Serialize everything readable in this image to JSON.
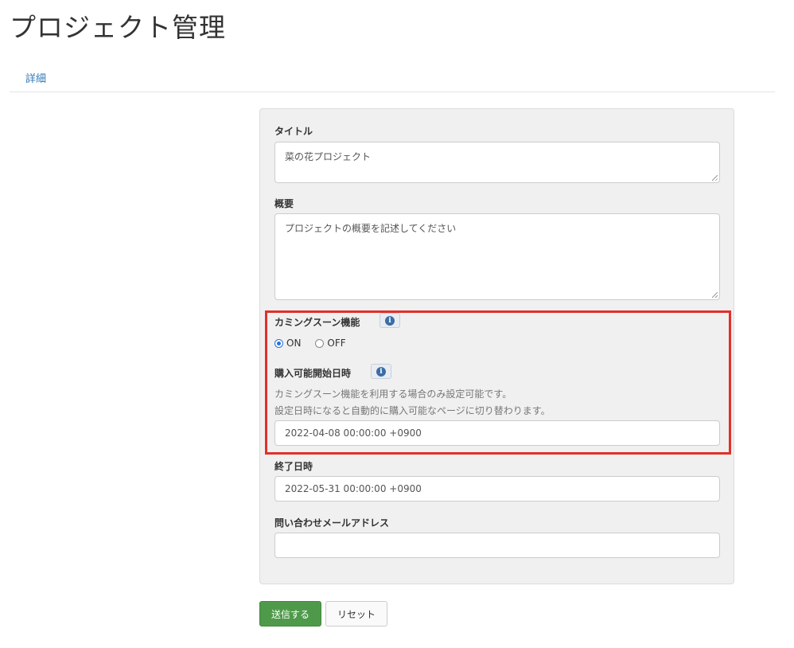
{
  "page": {
    "title": "プロジェクト管理"
  },
  "nav": {
    "tab_detail": "詳細"
  },
  "form": {
    "title_label": "タイトル",
    "title_value": "菜の花プロジェクト",
    "summary_label": "概要",
    "summary_placeholder": "プロジェクトの概要を記述してください",
    "coming_soon_label": "カミングスーン機能",
    "coming_soon_options": [
      "ON",
      "OFF"
    ],
    "coming_soon_selected": "ON",
    "purchase_start_label": "購入可能開始日時",
    "purchase_start_help_1": "カミングスーン機能を利用する場合のみ設定可能です。",
    "purchase_start_help_2": "設定日時になると自動的に購入可能なページに切り替わります。",
    "purchase_start_value": "2022-04-08 00:00:00 +0900",
    "end_date_label": "終了日時",
    "end_date_value": "2022-05-31 00:00:00 +0900",
    "contact_email_label": "問い合わせメールアドレス",
    "contact_email_value": ""
  },
  "buttons": {
    "submit": "送信する",
    "reset": "リセット"
  },
  "icons": {
    "info": "info-icon"
  },
  "colors": {
    "highlight": "#e0312a",
    "submit_bg": "#4f9a4a",
    "link": "#337ab7",
    "radio_accent": "#2a72d8"
  }
}
